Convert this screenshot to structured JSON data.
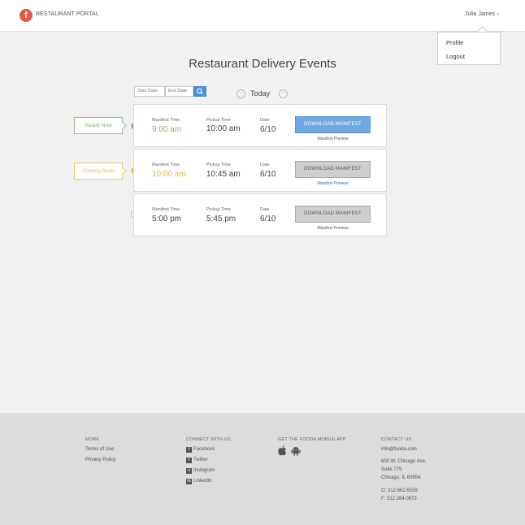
{
  "header": {
    "logo_glyph": "f",
    "brand": "RESTAURANT PORTAL",
    "user_name": "Julia James",
    "chevron": "⌄"
  },
  "user_dropdown": {
    "items": [
      {
        "label": "Profile"
      },
      {
        "label": "Logout"
      }
    ]
  },
  "page_title": "Restaurant Delivery Events",
  "date_filter": {
    "start_placeholder": "Start Date",
    "end_placeholder": "End Date",
    "search_icon": "search-icon"
  },
  "day_nav": {
    "prev": "‹",
    "label": "Today",
    "next": "›"
  },
  "labels": {
    "manifest_time": "Manifest Time",
    "pickup_time": "Pickup Time",
    "date": "Date",
    "download": "DOWNLOAD MANIFEST",
    "preview": "Manifest Preview"
  },
  "events": [
    {
      "status": "Ready Now",
      "status_color": "#7ab56f",
      "manifest_time": "9:00 am",
      "pickup_time": "10:00 am",
      "date": "6/10",
      "button_style": "blue"
    },
    {
      "status": "Coming Soon",
      "status_color": "#f0b43d",
      "manifest_time": "10:00 am",
      "pickup_time": "10:45 am",
      "date": "6/10",
      "button_style": "gray"
    },
    {
      "status": "",
      "manifest_time": "5:00 pm",
      "pickup_time": "5:45 pm",
      "date": "6/10",
      "button_style": "gray"
    }
  ],
  "footer": {
    "more": {
      "heading": "MORE",
      "links": [
        "Terms of Use",
        "Privacy Policy"
      ]
    },
    "connect": {
      "heading": "CONNECT WITH US",
      "links": [
        "Facebook",
        "Twitter",
        "Instagram",
        "LinkedIn"
      ]
    },
    "app": {
      "heading": "GET THE FOODA MOBILE APP"
    },
    "contact": {
      "heading": "CONTACT US",
      "email": "info@fooda.com",
      "address": [
        "600 W. Chicago Ave.",
        "Suite 775",
        "Chicago, IL 60654"
      ],
      "phone": "O: 312.662.6539",
      "fax": "F: 312.264.0673"
    }
  },
  "colors": {
    "accent": "#e8573f",
    "primary_button": "#6fa9e0",
    "ready": "#8ac37e",
    "soon": "#f3c15c"
  }
}
